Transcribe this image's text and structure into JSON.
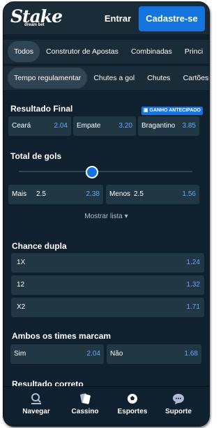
{
  "header": {
    "logo_text": "Stake",
    "logo_sub": "dream bet",
    "login_label": "Entrar",
    "register_label": "Cadastre-se"
  },
  "tabs_primary": [
    "Todos",
    "Construtor de Apostas",
    "Combinadas",
    "Princi"
  ],
  "tabs_secondary": [
    "Tempo regulamentar",
    "Chutes a gol",
    "Chutes",
    "Cartões"
  ],
  "resultado_final": {
    "title": "Resultado Final",
    "badge": "GANHO ANTECIPADO",
    "odds": [
      {
        "label": "Ceará",
        "value": "2.04"
      },
      {
        "label": "Empate",
        "value": "3.20"
      },
      {
        "label": "Bragantino",
        "value": "3.85"
      }
    ]
  },
  "total_gols": {
    "title": "Total de gols",
    "slider_position_fraction": 0.42,
    "over": {
      "label": "Mais",
      "line": "2.5",
      "value": "2.38"
    },
    "under": {
      "label": "Menos",
      "line": "2.5",
      "value": "1.56"
    },
    "show_list": "Mostrar lista"
  },
  "chance_dupla": {
    "title": "Chance dupla",
    "odds": [
      {
        "label": "1X",
        "value": "1.24"
      },
      {
        "label": "12",
        "value": "1.32"
      },
      {
        "label": "X2",
        "value": "1.71"
      }
    ]
  },
  "ambos_marcam": {
    "title": "Ambos os times marcam",
    "odds": [
      {
        "label": "Sim",
        "value": "2.04"
      },
      {
        "label": "Não",
        "value": "1.68"
      }
    ]
  },
  "next_section_title": "Resultado correto",
  "bottom_nav": [
    {
      "label": "Navegar",
      "icon": "browse-icon"
    },
    {
      "label": "Cassino",
      "icon": "casino-cards-icon"
    },
    {
      "label": "Esportes",
      "icon": "sports-ball-icon"
    },
    {
      "label": "Suporte",
      "icon": "chat-bubble-icon"
    }
  ],
  "colors": {
    "background": "#0f212e",
    "surface": "#1a2c38",
    "odd_button": "#213743",
    "accent_blue": "#1475e1",
    "odd_value": "#5fa8ff"
  }
}
